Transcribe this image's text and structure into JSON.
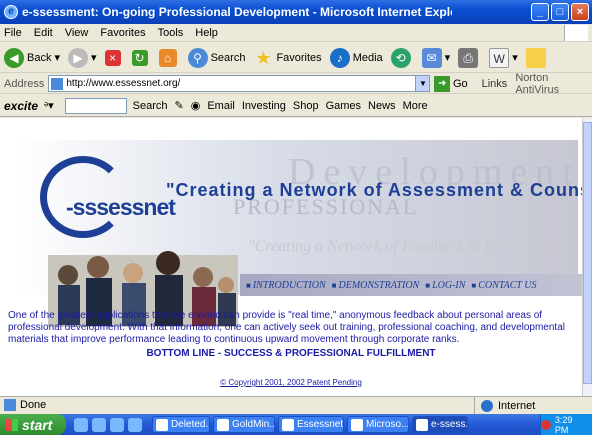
{
  "window": {
    "title": "e-ssessment: On-going Professional Development - Microsoft Internet Explorer"
  },
  "menu": [
    "File",
    "Edit",
    "View",
    "Favorites",
    "Tools",
    "Help"
  ],
  "toolbar": {
    "back": "Back",
    "search": "Search",
    "favorites": "Favorites",
    "media": "Media"
  },
  "address": {
    "label": "Address",
    "url": "http://www.essessnet.org/",
    "go": "Go",
    "links": "Links",
    "norton": "Norton AntiVirus"
  },
  "excite": {
    "logo": "excite",
    "search_btn": "Search",
    "email": "Email",
    "investing": "Investing",
    "shop": "Shop",
    "games": "Games",
    "news": "News",
    "more": "More"
  },
  "page": {
    "tagline": "\"Creating a Network of Assessment & Counsel\"",
    "logo_text": "-sssessnet",
    "ghost_title": "Development!",
    "ghost_subtitle": "PROFESSIONAL",
    "ghost_tagline": "\"Creating a Network of Feedback & Development\"",
    "nav": [
      "INTRODUCTION",
      "DEMONSTRATION",
      "LOG-IN",
      "CONTACT US"
    ],
    "body": "One of the greatest applications that the e-world can provide is \"real time,\" anonymous feedback about personal areas of professional development. With that information, one can actively seek out training, professional coaching, and developmental materials that improve performance leading to continuous upward movement through corporate ranks.",
    "bottom_line": "BOTTOM LINE - SUCCESS & PROFESSIONAL FULFILLMENT",
    "copyright": "© Copyright 2001, 2002 Patent Pending"
  },
  "status": {
    "text": "Done",
    "zone": "Internet"
  },
  "taskbar": {
    "start": "start",
    "tasks": [
      "Deleted...",
      "GoldMin...",
      "Essessnet",
      "Microso...",
      "e-ssess..."
    ],
    "clock": "3:29 PM"
  },
  "colors": {
    "brand_blue": "#1d3f95",
    "link_blue": "#1a1aa6"
  }
}
